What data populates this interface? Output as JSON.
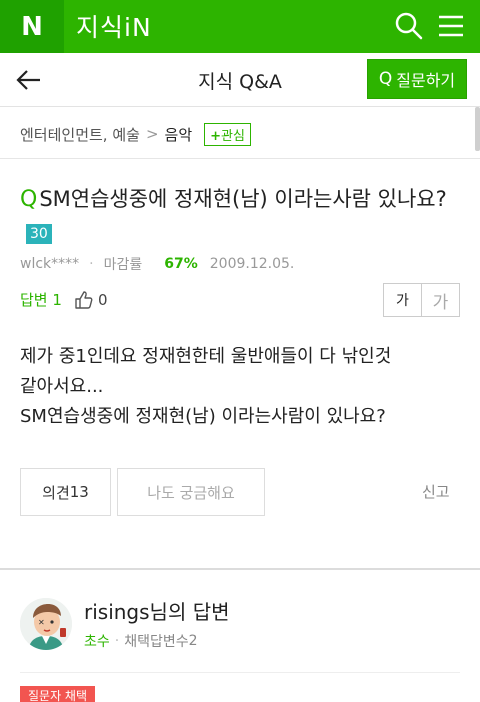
{
  "header": {
    "logo": "N",
    "brand": "지식iN",
    "icons": [
      "search-icon",
      "menu-icon"
    ]
  },
  "titlebar": {
    "back_icon": "arrow-left-icon",
    "title": "지식 Q&A",
    "ask_button": {
      "q": "Q",
      "label": "질문하기"
    }
  },
  "breadcrumb": {
    "category": "엔터테인먼트, 예술",
    "separator": ">",
    "current": "음악",
    "interest_plus": "+",
    "interest_label": "관심"
  },
  "question": {
    "q_mark": "Q",
    "title": "SM연습생중에 정재현(남) 이라는사람 있나요?",
    "points": "30",
    "author": "wlck****",
    "deadline_label": "마감률",
    "deadline_rate": "67%",
    "date": "2009.12.05.",
    "answers_label": "답변",
    "answers_count": "1",
    "likes": "0",
    "font_small": "가",
    "font_large": "가",
    "body_line1": "제가 중1인데요 정재현한테 울반애들이 다 낚인것",
    "body_line2": "같아서요...",
    "body_line3": "SM연습생중에 정재현(남) 이라는사람이 있나요?",
    "opinion_label": "의견",
    "opinion_count": "13",
    "curious_label": "나도 궁금해요",
    "report_label": "신고"
  },
  "answer": {
    "name": "risings님의 답변",
    "grade": "초수",
    "adopted_label": "채택답변수",
    "adopted_count": "2",
    "badge": "질문자 채택"
  },
  "colors": {
    "brand_green": "#2db400",
    "points_teal": "#2bb3ba",
    "badge_red": "#f25550"
  }
}
